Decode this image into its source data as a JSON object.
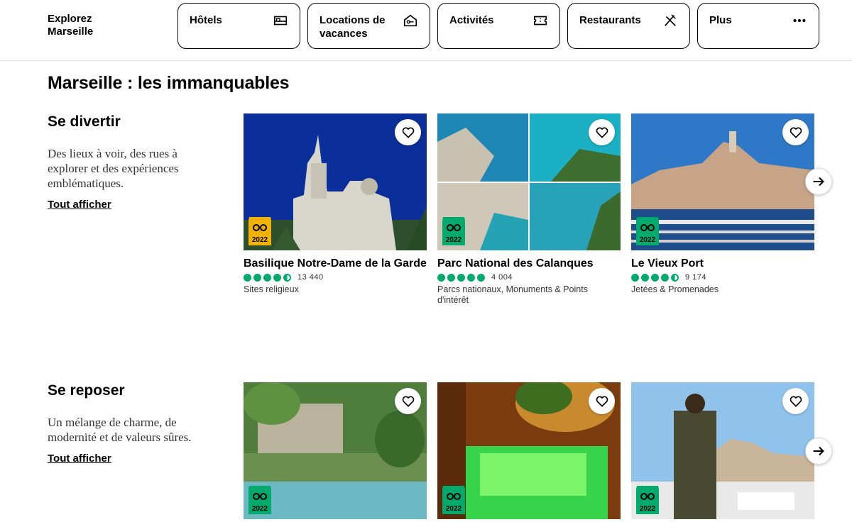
{
  "brand": {
    "line1": "Explorez",
    "line2": "Marseille"
  },
  "nav": [
    {
      "label": "Hôtels",
      "icon": "bed-icon"
    },
    {
      "label": "Locations de vacances",
      "icon": "house-key-icon"
    },
    {
      "label": "Activités",
      "icon": "ticket-icon"
    },
    {
      "label": "Restaurants",
      "icon": "fork-knife-icon"
    },
    {
      "label": "Plus",
      "icon": "more-dots-icon"
    }
  ],
  "section_title": "Marseille : les immanquables",
  "categories": [
    {
      "title": "Se divertir",
      "description": "Des lieux à voir, des rues à explorer et des expériences emblématiques.",
      "link": "Tout afficher",
      "cards": [
        {
          "name": "Basilique Notre-Dame de la Garde",
          "rating": 4.5,
          "reviews": "13 440",
          "tags": "Sites religieux",
          "award": "2022"
        },
        {
          "name": "Parc National des Calanques",
          "rating": 5,
          "reviews": "4 004",
          "tags": "Parcs nationaux, Monuments & Points d'intérêt",
          "award": "2022"
        },
        {
          "name": "Le Vieux Port",
          "rating": 4.5,
          "reviews": "9 174",
          "tags": "Jetées & Promenades",
          "award": "2022"
        }
      ]
    },
    {
      "title": "Se reposer",
      "description": "Un mélange de charme, de modernité et de valeurs sûres.",
      "link": "Tout afficher",
      "cards": [
        {
          "award": "2022"
        },
        {
          "award": "2022"
        },
        {
          "award": "2022"
        }
      ]
    }
  ],
  "colors": {
    "rating": "#00aa6c",
    "award_gold": "#f2b203",
    "award_green": "#00aa6c"
  }
}
